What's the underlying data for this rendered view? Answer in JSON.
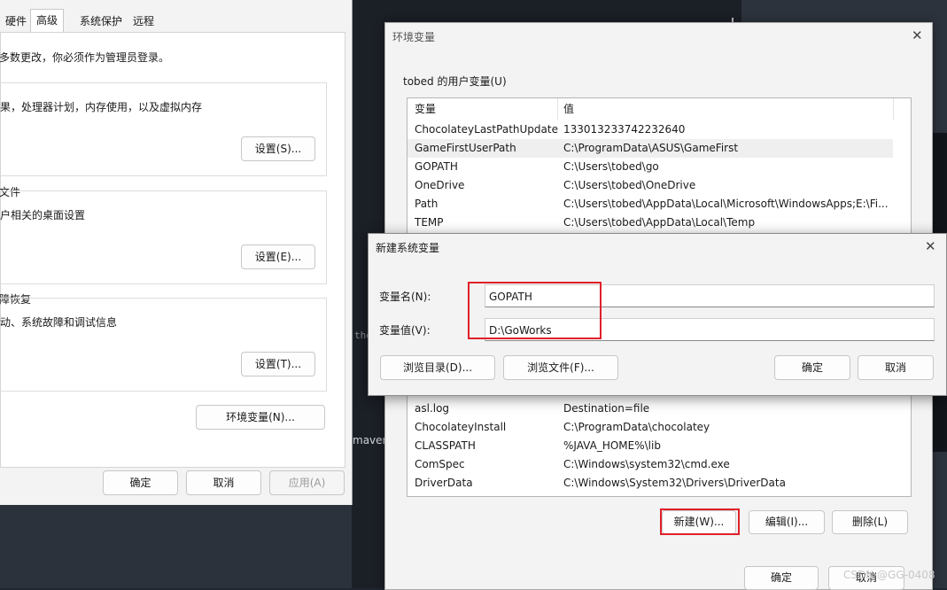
{
  "background": {
    "terminal_fragment": "the",
    "maven_fragment": "maven"
  },
  "system_properties": {
    "tabs": [
      "硬件",
      "高级",
      "系统保护",
      "远程"
    ],
    "admin_note": "多数更改，你必须作为管理员登录。",
    "performance_desc": "果，处理器计划，内存使用，以及虚拟内存",
    "performance_settings": "设置(S)...",
    "profile_title": "文件",
    "profile_desc": "户相关的桌面设置",
    "profile_settings": "设置(E)...",
    "startup_title": "障恢复",
    "startup_desc": "动、系统故障和调试信息",
    "startup_settings": "设置(T)...",
    "env_vars_button": "环境变量(N)...",
    "ok": "确定",
    "cancel": "取消",
    "apply": "应用(A)"
  },
  "env_dialog": {
    "title": "环境变量",
    "user_group": "tobed 的用户变量(U)",
    "col_var": "变量",
    "col_val": "值",
    "user_vars": [
      {
        "name": "ChocolateyLastPathUpdate",
        "value": "133013233742232640"
      },
      {
        "name": "GameFirstUserPath",
        "value": "C:\\ProgramData\\ASUS\\GameFirst"
      },
      {
        "name": "GOPATH",
        "value": "C:\\Users\\tobed\\go"
      },
      {
        "name": "OneDrive",
        "value": "C:\\Users\\tobed\\OneDrive"
      },
      {
        "name": "Path",
        "value": "C:\\Users\\tobed\\AppData\\Local\\Microsoft\\WindowsApps;E:\\Fi..."
      },
      {
        "name": "TEMP",
        "value": "C:\\Users\\tobed\\AppData\\Local\\Temp"
      }
    ],
    "system_vars": [
      {
        "name": "asl.log",
        "value": "Destination=file"
      },
      {
        "name": "ChocolateyInstall",
        "value": "C:\\ProgramData\\chocolatey"
      },
      {
        "name": "CLASSPATH",
        "value": "%JAVA_HOME%\\lib"
      },
      {
        "name": "ComSpec",
        "value": "C:\\Windows\\system32\\cmd.exe"
      },
      {
        "name": "DriverData",
        "value": "C:\\Windows\\System32\\Drivers\\DriverData"
      }
    ],
    "new_button": "新建(W)...",
    "edit_button": "编辑(I)...",
    "delete_button": "删除(L)",
    "ok": "确定",
    "cancel": "取消"
  },
  "new_var_dialog": {
    "title": "新建系统变量",
    "name_label": "变量名(N):",
    "value_label": "变量值(V):",
    "name_value": "GOPATH",
    "value_value": "D:\\GoWorks",
    "browse_dir": "浏览目录(D)...",
    "browse_file": "浏览文件(F)...",
    "ok": "确定",
    "cancel": "取消"
  },
  "watermark": "CSDN @GG-0408",
  "colors": {
    "highlight_red": "#e0202a",
    "dialog_bg": "#f3f3f3"
  }
}
